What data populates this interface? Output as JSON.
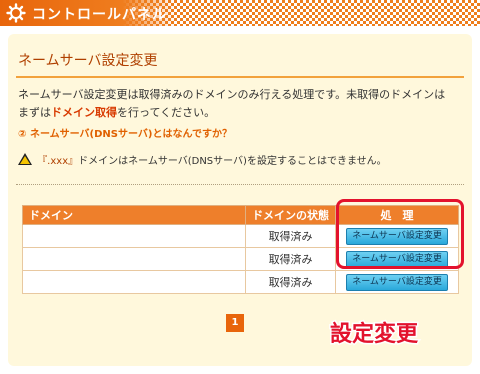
{
  "header": {
    "title": "コントロールパネル",
    "icon": "gear-icon",
    "accent_color": "#ee7e1c"
  },
  "panel": {
    "title": "ネームサーバ設定変更",
    "description_line1": "ネームサーバ設定変更は取得済みのドメインのみ行える処理です。未取得のドメインは",
    "description_line2_pre": "まずは",
    "description_line2_link": "ドメイン取得",
    "description_line2_post": "を行ってください。",
    "faq_link": "② ネームサーバ(DNSサーバ)とはなんですか？",
    "warning_bracket": "『.xxx』",
    "warning_text": "ドメインはネームサーバ(DNSサーバ)を設定することはできません。"
  },
  "table": {
    "headers": {
      "domain": "ドメイン",
      "status": "ドメインの状態",
      "action": "処　理"
    },
    "rows": [
      {
        "domain": "",
        "status": "取得済み",
        "action": "ネームサーバ設定変更"
      },
      {
        "domain": "",
        "status": "取得済み",
        "action": "ネームサーバ設定変更"
      },
      {
        "domain": "",
        "status": "取得済み",
        "action": "ネームサーバ設定変更"
      }
    ]
  },
  "pagination": {
    "current": "1"
  },
  "annotation": {
    "text": "設定変更",
    "color": "#e3122d"
  }
}
